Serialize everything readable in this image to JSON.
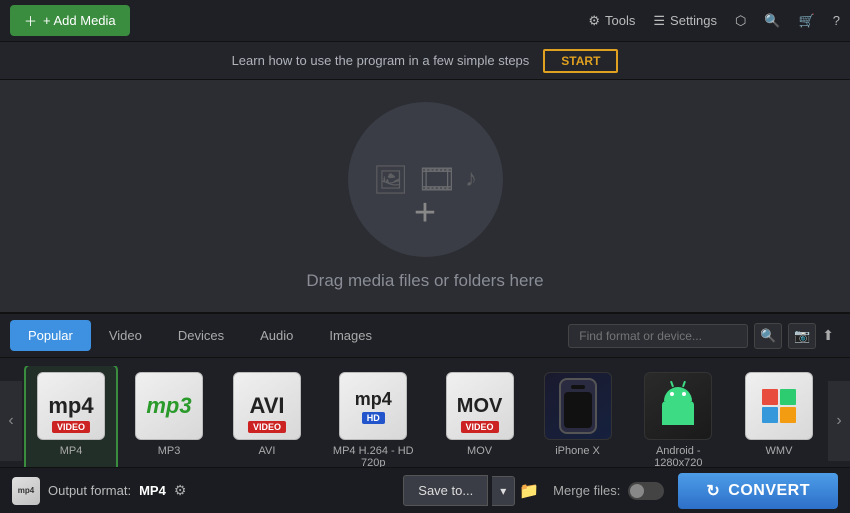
{
  "toolbar": {
    "add_media_label": "+ Add Media",
    "tools_label": "Tools",
    "settings_label": "Settings",
    "share_icon": "◄►",
    "search_icon": "🔍",
    "cart_icon": "🛒",
    "help_icon": "?"
  },
  "info_bar": {
    "text": "Learn how to use the program in a few simple steps",
    "start_label": "START"
  },
  "drop_zone": {
    "text": "Drag media files or folders here"
  },
  "format_panel": {
    "tabs": [
      {
        "id": "popular",
        "label": "Popular",
        "active": true
      },
      {
        "id": "video",
        "label": "Video",
        "active": false
      },
      {
        "id": "devices",
        "label": "Devices",
        "active": false
      },
      {
        "id": "audio",
        "label": "Audio",
        "active": false
      },
      {
        "id": "images",
        "label": "Images",
        "active": false
      }
    ],
    "search_placeholder": "Find format or device...",
    "formats": [
      {
        "id": "mp4",
        "label": "MP4",
        "badge": "VIDEO",
        "badge_color": "red",
        "selected": true
      },
      {
        "id": "mp3",
        "label": "MP3",
        "badge": "",
        "badge_color": ""
      },
      {
        "id": "avi",
        "label": "AVI",
        "badge": "VIDEO",
        "badge_color": "red"
      },
      {
        "id": "mp4hd",
        "label": "MP4 H.264 - HD 720p",
        "badge": "HD",
        "badge_color": "blue"
      },
      {
        "id": "mov",
        "label": "MOV",
        "badge": "VIDEO",
        "badge_color": "red"
      },
      {
        "id": "iphone",
        "label": "iPhone X",
        "badge": "",
        "badge_color": ""
      },
      {
        "id": "android",
        "label": "Android - 1280x720",
        "badge": "",
        "badge_color": ""
      },
      {
        "id": "wmv",
        "label": "WMV",
        "badge": "",
        "badge_color": ""
      }
    ]
  },
  "bottom_bar": {
    "output_label": "Output format:",
    "output_format": "MP4",
    "save_to_label": "Save to...",
    "merge_files_label": "Merge files:",
    "convert_label": "CONVERT"
  }
}
